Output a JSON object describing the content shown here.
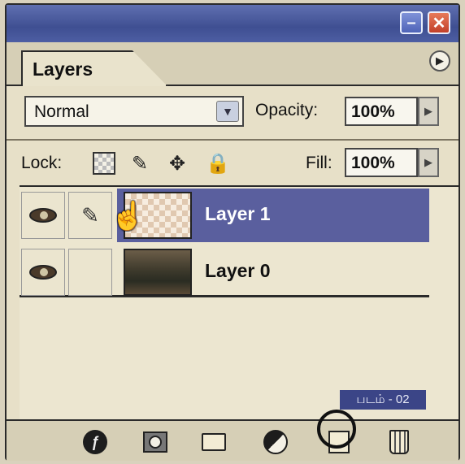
{
  "panel": {
    "tab_label": "Layers"
  },
  "blend": {
    "mode": "Normal",
    "opacity_label": "Opacity:",
    "opacity_value": "100%"
  },
  "lock": {
    "label": "Lock:",
    "fill_label": "Fill:",
    "fill_value": "100%"
  },
  "layers": [
    {
      "name": "Layer 1",
      "selected": true,
      "visible": true
    },
    {
      "name": "Layer 0",
      "selected": false,
      "visible": true
    }
  ],
  "caption": "படம் - 02",
  "colors": {
    "selection": "#5a5f9e",
    "titlebar": "#3f4f92",
    "caption_bg": "#3b4587"
  },
  "icons": [
    "minimize-icon",
    "close-icon",
    "panel-menu-icon",
    "dropdown-arrow-icon",
    "lock-transparency-icon",
    "lock-brush-icon",
    "lock-move-icon",
    "lock-all-icon",
    "eye-icon",
    "brush-link-icon",
    "hand-cursor-icon",
    "layer-style-icon",
    "layer-mask-icon",
    "new-group-icon",
    "adjustment-layer-icon",
    "new-layer-icon",
    "trash-icon"
  ]
}
